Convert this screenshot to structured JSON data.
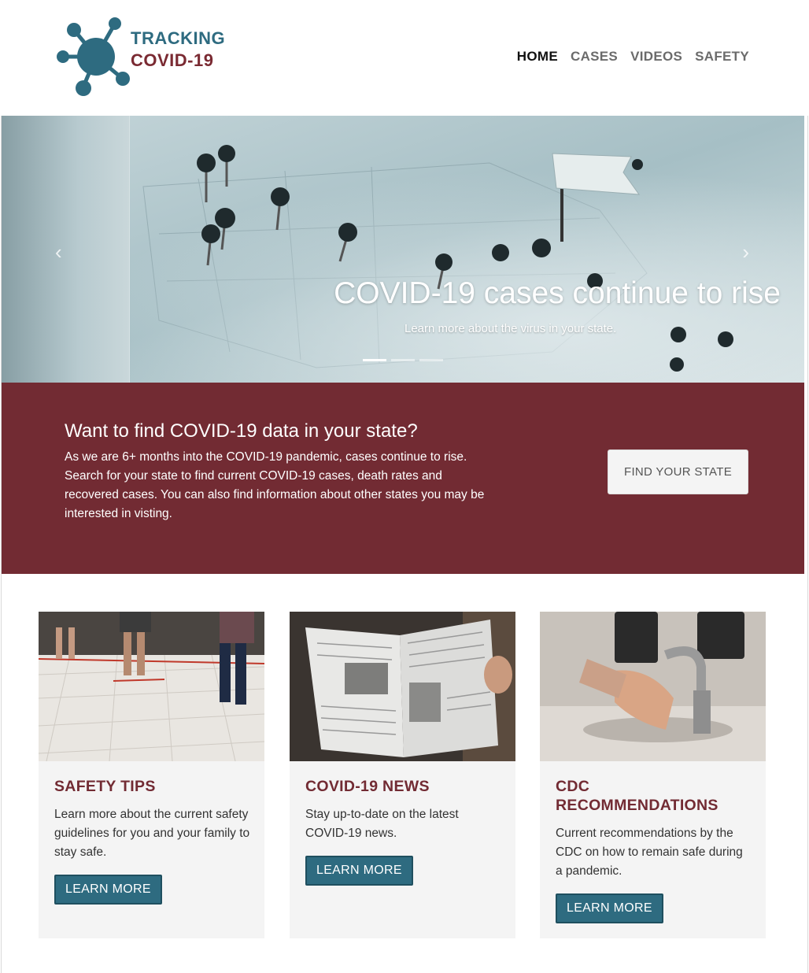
{
  "brand": {
    "line1": "TRACKING",
    "line2": "COVID-19",
    "colors": {
      "teal": "#2e6b80",
      "maroon": "#722b33"
    }
  },
  "nav": {
    "items": [
      {
        "label": "HOME",
        "active": true
      },
      {
        "label": "CASES",
        "active": false
      },
      {
        "label": "VIDEOS",
        "active": false
      },
      {
        "label": "SAFETY",
        "active": false
      }
    ]
  },
  "hero": {
    "title": "COVID-19 cases continue to rise",
    "subtitle": "Learn more about the virus in your state.",
    "prev_icon": "‹",
    "next_icon": "›",
    "slide_count": 3,
    "active_slide": 1
  },
  "cta": {
    "heading": "Want to find COVID-19 data in your state?",
    "text": "As we are 6+ months into the COVID-19 pandemic, cases continue to rise. Search for your state to find current COVID-19 cases, death rates and recovered cases. You can also find information about other states you may be interested in visting.",
    "button": "FIND YOUR STATE"
  },
  "cards": [
    {
      "title": "SAFETY TIPS",
      "text": "Learn more about the current safety guidelines for you and your family to stay safe.",
      "button": "LEARN MORE"
    },
    {
      "title": "COVID-19 NEWS",
      "text": "Stay up-to-date on the latest COVID-19 news.",
      "button": "LEARN MORE"
    },
    {
      "title": "CDC RECOMMENDATIONS",
      "text": "Current recommendations by the CDC on how to remain safe during a pandemic.",
      "button": "LEARN MORE"
    }
  ]
}
